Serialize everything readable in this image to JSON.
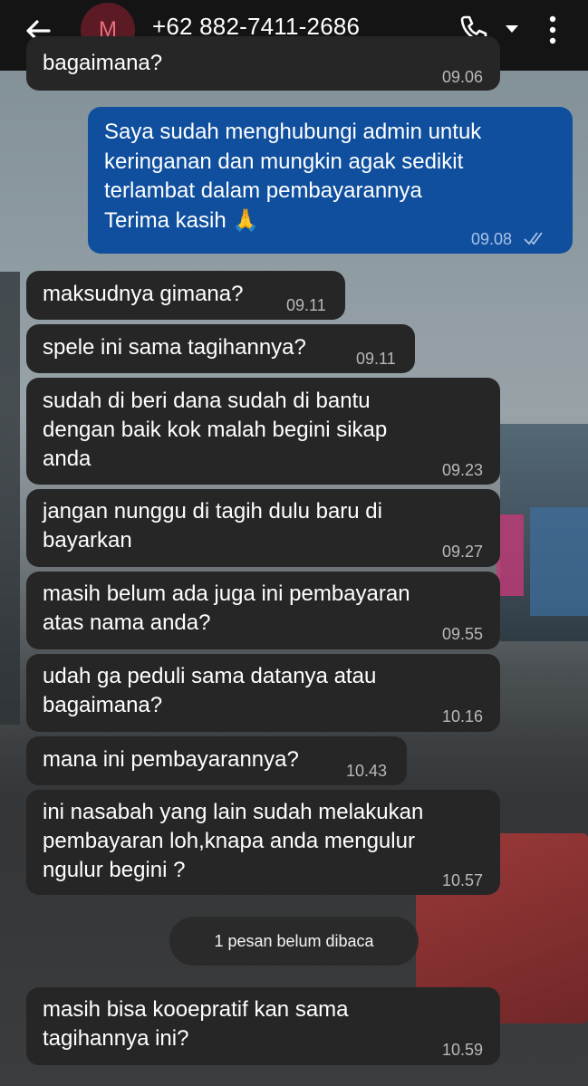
{
  "header": {
    "avatar_letter": "M",
    "contact": "+62 882-7411-2686"
  },
  "messages": [
    {
      "dir": "in",
      "text": "bagaimana?",
      "time": "09.06"
    },
    {
      "dir": "out",
      "text": "Saya sudah menghubungi admin untuk\nkeringanan dan mungkin agak sedikit\nterlambat dalam pembayarannya\nTerima kasih 🙏",
      "time": "09.08"
    },
    {
      "dir": "in",
      "text": "maksudnya gimana?",
      "time": "09.11"
    },
    {
      "dir": "in",
      "text": "spele ini sama tagihannya?",
      "time": "09.11"
    },
    {
      "dir": "in",
      "text": "sudah di beri dana sudah di bantu\ndengan baik kok malah begini sikap\nanda",
      "time": "09.23"
    },
    {
      "dir": "in",
      "text": "jangan nunggu di tagih dulu baru di\nbayarkan",
      "time": "09.27"
    },
    {
      "dir": "in",
      "text": "masih belum ada juga ini pembayaran\natas nama anda?",
      "time": "09.55"
    },
    {
      "dir": "in",
      "text": "udah ga peduli sama datanya atau\nbagaimana?",
      "time": "10.16"
    },
    {
      "dir": "in",
      "text": "mana ini pembayarannya?",
      "time": "10.43"
    },
    {
      "dir": "in",
      "text": "ini nasabah yang lain sudah melakukan\npembayaran loh,knapa anda mengulur\nngulur begini ?",
      "time": "10.57"
    },
    {
      "dir": "in",
      "text": "masih bisa kooepratif kan sama\ntagihannya ini?",
      "time": "10.59"
    }
  ],
  "unread_banner": "1 pesan belum dibaca",
  "colors": {
    "incoming": "#262626",
    "outgoing": "#0f4f9e",
    "topbar": "#141414"
  }
}
